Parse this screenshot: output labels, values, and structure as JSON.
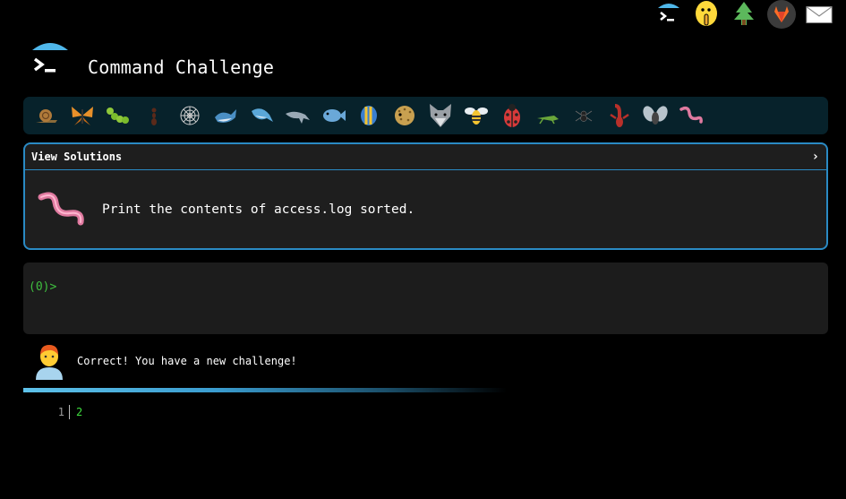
{
  "header": {
    "title": "Command Challenge"
  },
  "top_icons": [
    "terminal-logo-icon",
    "shushing-face-icon",
    "tree-icon",
    "gitlab-icon",
    "mail-icon"
  ],
  "animals": [
    "snail",
    "butterfly",
    "caterpillar",
    "ant",
    "spider-web",
    "whale",
    "dolphin-spout",
    "dolphin",
    "fish",
    "tropical-fish",
    "blowfish",
    "wolf",
    "bee",
    "ladybug",
    "cricket",
    "spider",
    "scorpion",
    "fly",
    "worm"
  ],
  "panel": {
    "view_solutions": "View Solutions",
    "chevron": "›",
    "task": "Print the contents of access.log sorted."
  },
  "terminal": {
    "prompt": "(0)>"
  },
  "message": {
    "text": "Correct! You have a new challenge!"
  },
  "output": {
    "line_number": "1",
    "line_text": "2"
  },
  "colors": {
    "accent": "#2a8ac4",
    "prompt": "#3fbf3f",
    "bar": "#07222b"
  }
}
